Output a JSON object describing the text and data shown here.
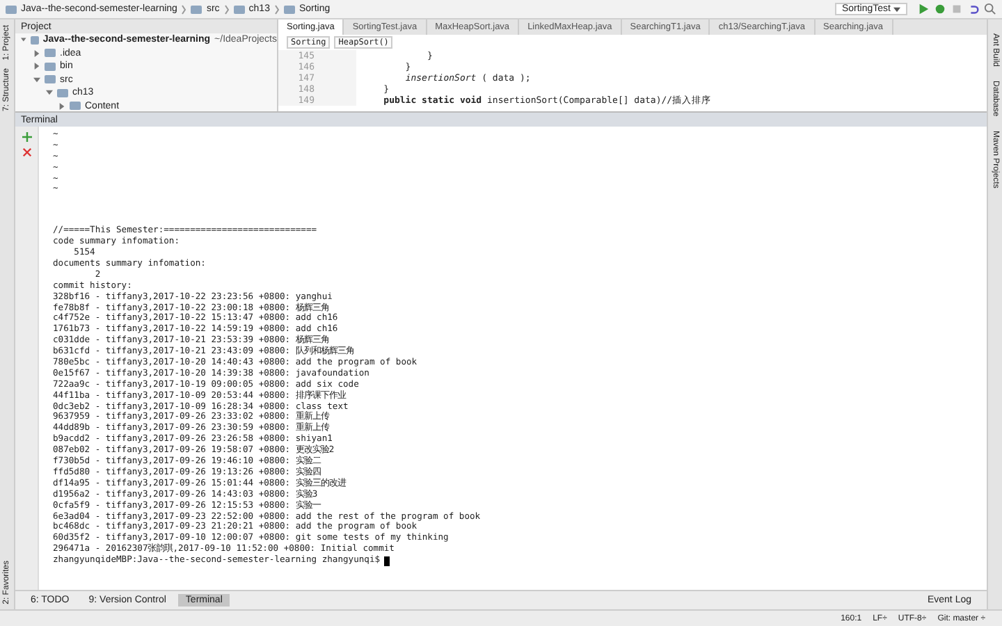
{
  "breadcrumbs": [
    "Java--the-second-semester-learning",
    "src",
    "ch13",
    "Sorting"
  ],
  "run_config": "SortingTest",
  "left_strip": [
    "1: Project",
    "7: Structure"
  ],
  "left_strip_bottom": [
    "2: Favorites"
  ],
  "right_strip": [
    "Ant Build",
    "Database",
    "Maven Projects"
  ],
  "project": {
    "title": "Project",
    "tree": [
      {
        "label": "Java--the-second-semester-learning",
        "note": "~/IdeaProjects",
        "expanded": true,
        "children": [
          {
            "label": ".idea",
            "expanded": false
          },
          {
            "label": "bin",
            "expanded": false
          },
          {
            "label": "src",
            "expanded": true,
            "children": [
              {
                "label": "ch13",
                "expanded": true,
                "children": [
                  {
                    "label": "Content",
                    "expanded": false
                  }
                ]
              }
            ]
          }
        ]
      }
    ]
  },
  "editor": {
    "tabs": [
      {
        "label": "Sorting.java",
        "selected": true
      },
      {
        "label": "SortingTest.java",
        "selected": false
      },
      {
        "label": "MaxHeapSort.java",
        "selected": false
      },
      {
        "label": "LinkedMaxHeap.java",
        "selected": false
      },
      {
        "label": "SearchingT1.java",
        "selected": false
      },
      {
        "label": "ch13/SearchingT.java",
        "selected": false
      },
      {
        "label": "Searching.java",
        "selected": false
      }
    ],
    "crumbs": [
      "Sorting",
      "HeapSort()"
    ],
    "lines": [
      {
        "number": "145",
        "code": "            }"
      },
      {
        "number": "146",
        "code": "        }"
      },
      {
        "number": "147",
        "code": "        *insertionSort* ( data );"
      },
      {
        "number": "148",
        "code": "    }"
      },
      {
        "number": "149",
        "code": "    **public static void** insertionSort(Comparable[] data)//插入排序"
      }
    ]
  },
  "terminal": {
    "title": "Terminal",
    "tildes": [
      "~",
      "~",
      "~",
      "~",
      "~",
      "~"
    ],
    "lines": [
      "//=====This Semester:=============================",
      "code summary infomation:",
      "    5154",
      "documents summary infomation:",
      "        2",
      "commit history:",
      "328bf16 - tiffany3,2017-10-22 23:23:56 +0800: yanghui",
      "fe78b8f - tiffany3,2017-10-22 23:00:18 +0800: 杨辉三角",
      "c4f752e - tiffany3,2017-10-22 15:13:47 +0800: add ch16",
      "1761b73 - tiffany3,2017-10-22 14:59:19 +0800: add ch16",
      "c031dde - tiffany3,2017-10-21 23:53:39 +0800: 杨辉三角",
      "b631cfd - tiffany3,2017-10-21 23:43:09 +0800: 队列和杨辉三角",
      "780e5bc - tiffany3,2017-10-20 14:40:43 +0800: add the program of book",
      "0e15f67 - tiffany3,2017-10-20 14:39:38 +0800: javafoundation",
      "722aa9c - tiffany3,2017-10-19 09:00:05 +0800: add six code",
      "44f11ba - tiffany3,2017-10-09 20:53:44 +0800: 排序课下作业",
      "0dc3eb2 - tiffany3,2017-10-09 16:28:34 +0800: class text",
      "9637959 - tiffany3,2017-09-26 23:33:02 +0800: 重新上传",
      "44dd89b - tiffany3,2017-09-26 23:30:59 +0800: 重新上传",
      "b9acdd2 - tiffany3,2017-09-26 23:26:58 +0800: shiyan1",
      "087eb02 - tiffany3,2017-09-26 19:58:07 +0800: 更改实验2",
      "f730b5d - tiffany3,2017-09-26 19:46:10 +0800: 实验二",
      "ffd5d80 - tiffany3,2017-09-26 19:13:26 +0800: 实验四",
      "df14a95 - tiffany3,2017-09-26 15:01:44 +0800: 实验三的改进",
      "d1956a2 - tiffany3,2017-09-26 14:43:03 +0800: 实验3",
      "0cfa5f9 - tiffany3,2017-09-26 12:15:53 +0800: 实验一",
      "6e3ad04 - tiffany3,2017-09-23 22:52:00 +0800: add the rest of the program of book",
      "bc468dc - tiffany3,2017-09-23 21:20:21 +0800: add the program of book",
      "60d35f2 - tiffany3,2017-09-10 12:00:07 +0800: git some tests of my thinking",
      "296471a - 20162307张韵琪,2017-09-10 11:52:00 +0800: Initial commit"
    ],
    "prompt": "zhangyunqideMBP:Java--the-second-semester-learning zhangyunqi$"
  },
  "tool_tabs": [
    {
      "label": "6: TODO",
      "selected": false
    },
    {
      "label": "9: Version Control",
      "selected": false
    },
    {
      "label": "Terminal",
      "selected": true
    }
  ],
  "event_log": "Event Log",
  "status": [
    "160:1",
    "LF÷",
    "UTF-8÷",
    "Git: master ÷"
  ]
}
